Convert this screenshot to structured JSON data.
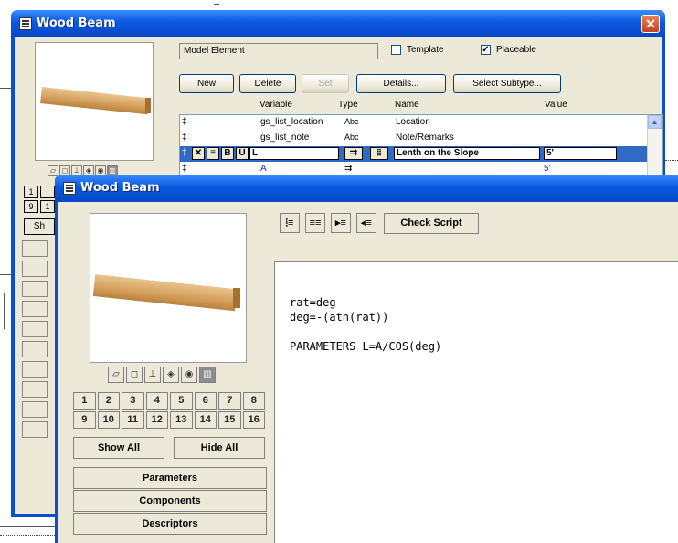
{
  "back_window": {
    "title": "Wood Beam",
    "close_glyph": "✕",
    "model_element_label": "Model Element",
    "template_label": "Template",
    "template_checked": false,
    "placeable_label": "Placeable",
    "placeable_checked": true,
    "check_glyph": "✓",
    "buttons": {
      "new": "New",
      "delete": "Delete",
      "set": "Set",
      "details": "Details...",
      "select_subtype": "Select Subtype..."
    },
    "columns": {
      "variable": "Variable",
      "type": "Type",
      "name": "Name",
      "value": "Value"
    },
    "rows": [
      {
        "handle": "‡",
        "variable": "gs_list_location",
        "type": "Abc",
        "name": "Location",
        "value": ""
      },
      {
        "handle": "‡",
        "variable": "gs_list_note",
        "type": "Abc",
        "name": "Note/Remarks",
        "value": ""
      },
      {
        "handle": "‡",
        "variable": "L",
        "type": "",
        "name": "Lenth on the Slope",
        "value": "5'"
      },
      {
        "handle": "‡",
        "variable": "A",
        "type": "",
        "name": "",
        "value": "5'"
      }
    ],
    "row_tools": {
      "x": "✕",
      "b": "B",
      "u": "U",
      "link": "⇉"
    },
    "left_numbers": [
      "1",
      "9",
      "1"
    ],
    "left_show": "Sh"
  },
  "front_window": {
    "title": "Wood Beam",
    "toolbar": {
      "check_script": "Check Script"
    },
    "view_icons": [
      "▱",
      "◻",
      "⊥",
      "◈",
      "◉",
      "▥"
    ],
    "numbers": [
      "1",
      "2",
      "3",
      "4",
      "5",
      "6",
      "7",
      "8",
      "9",
      "10",
      "11",
      "12",
      "13",
      "14",
      "15",
      "16"
    ],
    "show_all": "Show All",
    "hide_all": "Hide All",
    "panels": {
      "parameters": "Parameters",
      "components": "Components",
      "descriptors": "Descriptors"
    },
    "script": {
      "line1": "rat=deg",
      "line2": "deg=-(atn(rat))",
      "line3": "",
      "line4": "PARAMETERS L=A/COS(deg)"
    }
  },
  "colors": {
    "titlebar": "#0a58e0",
    "client": "#ece9d8",
    "selection": "#316ac5",
    "beam": "#d6a25f"
  }
}
